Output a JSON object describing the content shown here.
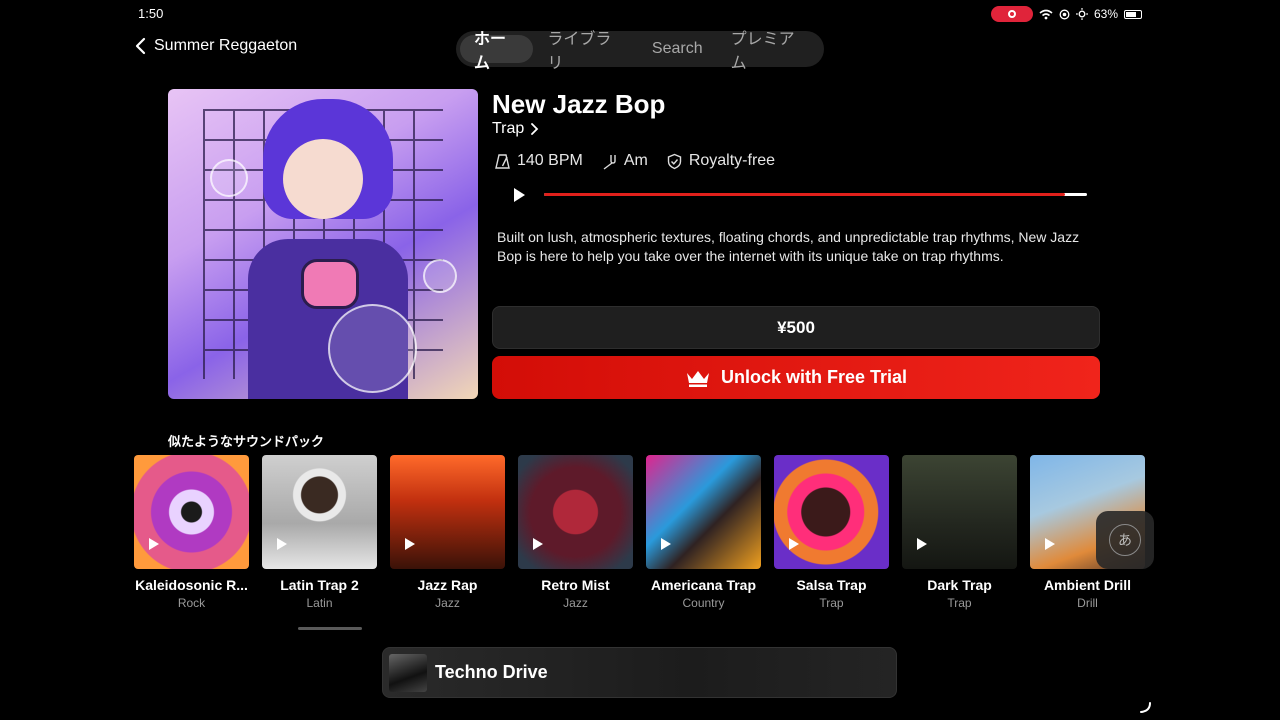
{
  "status": {
    "time": "1:50",
    "battery": "63%"
  },
  "nav": {
    "back_label": "Summer Reggaeton",
    "tabs": [
      {
        "label": "ホーム",
        "active": true
      },
      {
        "label": "ライブラリ",
        "active": false
      },
      {
        "label": "Search",
        "active": false
      },
      {
        "label": "プレミアム",
        "active": false
      }
    ]
  },
  "track": {
    "title": "New Jazz Bop",
    "genre": "Trap",
    "bpm": "140 BPM",
    "key": "Am",
    "license": "Royalty-free",
    "progress_fraction": 0.96,
    "description": "Built on lush, atmospheric textures, floating chords, and unpredictable trap rhythms, New Jazz Bop is here to help you take over the internet with its unique take on trap rhythms.",
    "price": "¥500",
    "unlock_label": "Unlock with Free Trial"
  },
  "similar": {
    "title": "似たようなサウンドパック",
    "packs": [
      {
        "name": "Kaleidosonic R...",
        "genre": "Rock"
      },
      {
        "name": "Latin Trap 2",
        "genre": "Latin"
      },
      {
        "name": "Jazz Rap",
        "genre": "Jazz"
      },
      {
        "name": "Retro Mist",
        "genre": "Jazz"
      },
      {
        "name": "Americana Trap",
        "genre": "Country"
      },
      {
        "name": "Salsa Trap",
        "genre": "Trap"
      },
      {
        "name": "Dark Trap",
        "genre": "Trap"
      },
      {
        "name": "Ambient Drill",
        "genre": "Drill"
      }
    ]
  },
  "ime": {
    "label": "あ"
  },
  "mini_player": {
    "title": "Techno Drive"
  },
  "colors": {
    "accent": "#e0201b",
    "background": "#000000"
  }
}
